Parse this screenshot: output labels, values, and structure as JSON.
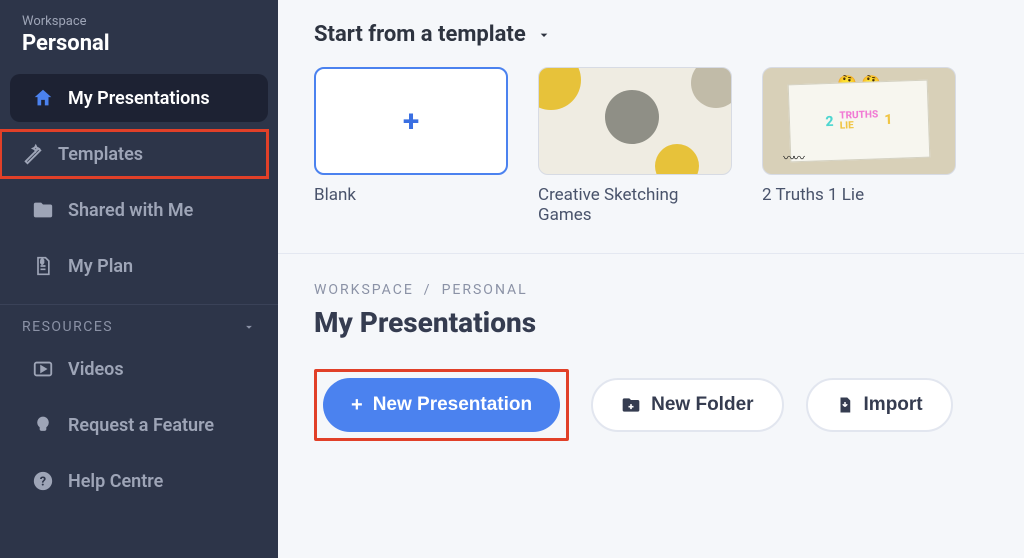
{
  "workspace": {
    "label": "Workspace",
    "name": "Personal"
  },
  "sidebar": {
    "items": [
      {
        "label": "My Presentations",
        "icon": "home-icon"
      },
      {
        "label": "Templates",
        "icon": "wand-icon"
      },
      {
        "label": "Shared with Me",
        "icon": "folder-shared-icon"
      },
      {
        "label": "My Plan",
        "icon": "invoice-icon"
      }
    ],
    "resources_header": "RESOURCES",
    "resources": [
      {
        "label": "Videos",
        "icon": "play-icon"
      },
      {
        "label": "Request a Feature",
        "icon": "lightbulb-icon"
      },
      {
        "label": "Help Centre",
        "icon": "help-icon"
      }
    ]
  },
  "templates": {
    "header": "Start from a template",
    "items": [
      {
        "label": "Blank"
      },
      {
        "label": "Creative Sketching Games"
      },
      {
        "label": "2 Truths 1 Lie"
      }
    ]
  },
  "breadcrumb": {
    "root": "WORKSPACE",
    "sep": "/",
    "leaf": "PERSONAL"
  },
  "page_title": "My Presentations",
  "actions": {
    "new_presentation": "New Presentation",
    "new_folder": "New Folder",
    "import": "Import"
  },
  "colors": {
    "accent": "#4b82ef",
    "highlight": "#e14028",
    "sidebar_bg": "#2d3549"
  }
}
